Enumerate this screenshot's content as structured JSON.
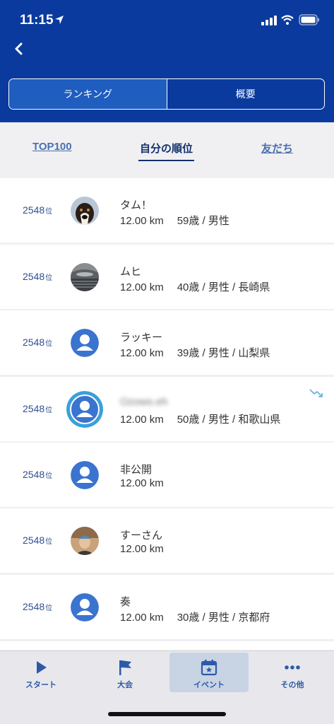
{
  "status_bar": {
    "time": "11:15"
  },
  "segments": [
    {
      "label": "ランキング",
      "active": true
    },
    {
      "label": "概要",
      "active": false
    }
  ],
  "subtabs": [
    {
      "label": "TOP100",
      "active": false
    },
    {
      "label": "自分の順位",
      "active": true
    },
    {
      "label": "友だち",
      "active": false
    }
  ],
  "rank_unit": "位",
  "rows": [
    {
      "rank": "2548",
      "name": "タム！",
      "distance": "12.00 km",
      "details": "59歳 / 男性",
      "avatar": "dog-photo"
    },
    {
      "rank": "2548",
      "name": "ムヒ",
      "distance": "12.00 km",
      "details": "40歳 / 男性 / 長崎県",
      "avatar": "stadium-photo"
    },
    {
      "rank": "2548",
      "name": "ラッキー",
      "distance": "12.00 km",
      "details": "39歳 / 男性 / 山梨県",
      "avatar": "default-user"
    },
    {
      "rank": "2548",
      "name": "Ozowo.eh",
      "distance": "12.00 km",
      "details": "50歳 / 男性 / 和歌山県",
      "avatar": "default-user-highlight",
      "self": true
    },
    {
      "rank": "2548",
      "name": "非公開",
      "distance": "12.00 km",
      "details": "",
      "avatar": "default-user"
    },
    {
      "rank": "2548",
      "name": "すーさん",
      "distance": "12.00 km",
      "details": "",
      "avatar": "person-photo"
    },
    {
      "rank": "2548",
      "name": "奏",
      "distance": "12.00 km",
      "details": "30歳 / 男性 / 京都府",
      "avatar": "default-user"
    }
  ],
  "tabbar": [
    {
      "label": "スタート",
      "icon": "play-icon",
      "active": false
    },
    {
      "label": "大会",
      "icon": "flag-icon",
      "active": false
    },
    {
      "label": "イベント",
      "icon": "calendar-icon",
      "active": true
    },
    {
      "label": "その他",
      "icon": "more-icon",
      "active": false
    }
  ],
  "colors": {
    "header": "#0a3a9e",
    "accent": "#2c5aa8",
    "trend": "#6ab4e0"
  }
}
